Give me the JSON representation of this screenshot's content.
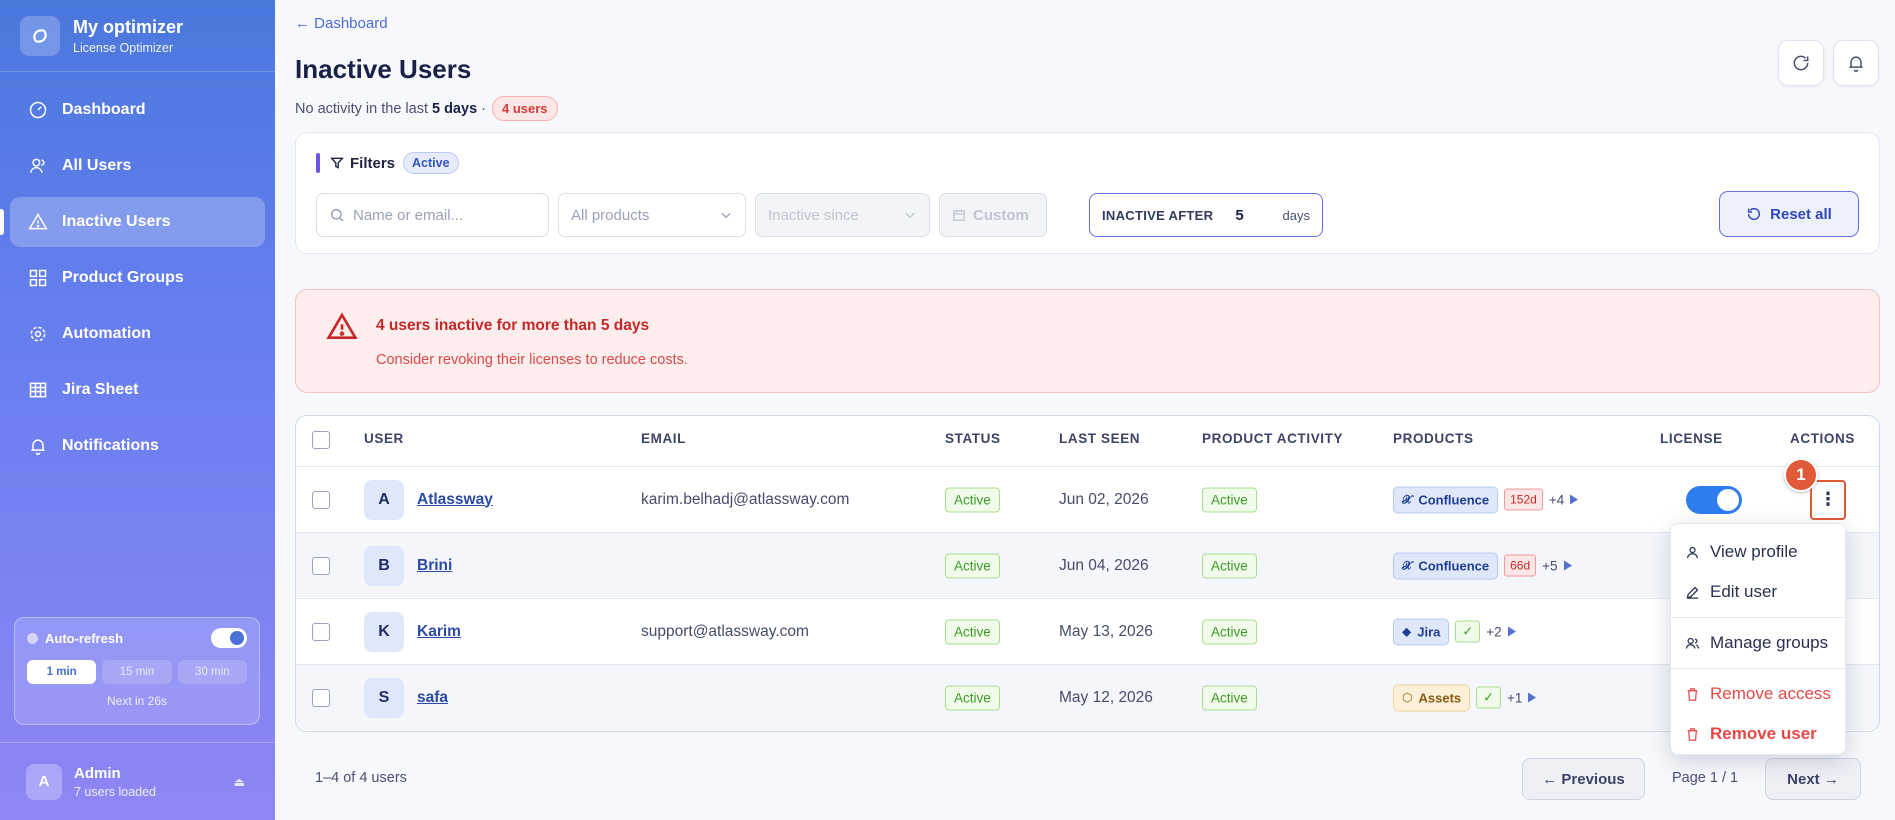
{
  "brand": {
    "name": "My optimizer",
    "subtitle": "License Optimizer"
  },
  "sidebar": {
    "items": [
      {
        "label": "Dashboard",
        "icon": "gauge-icon"
      },
      {
        "label": "All Users",
        "icon": "users-icon"
      },
      {
        "label": "Inactive Users",
        "icon": "warning-icon",
        "active": true
      },
      {
        "label": "Product Groups",
        "icon": "grid-icon"
      },
      {
        "label": "Automation",
        "icon": "gear-icon"
      },
      {
        "label": "Jira Sheet",
        "icon": "table-icon"
      },
      {
        "label": "Notifications",
        "icon": "bell-icon"
      }
    ],
    "autorefresh": {
      "label": "Auto-refresh",
      "enabled": true,
      "options": [
        "1 min",
        "15 min",
        "30 min"
      ],
      "selected": "1 min",
      "next": "Next in 26s"
    },
    "user": {
      "initial": "A",
      "name": "Admin",
      "sub": "7 users loaded"
    }
  },
  "header": {
    "back": "← Dashboard",
    "title": "Inactive Users",
    "subtitle_prefix": "No activity in the last",
    "subtitle_days": "5 days",
    "subtitle_sep": "·",
    "count_badge": "4 users"
  },
  "filters": {
    "title": "Filters",
    "status": "Active",
    "search_placeholder": "Name or email...",
    "products": "All products",
    "inactive_since": "Inactive since",
    "custom": "Custom",
    "inactive_after_label": "INACTIVE AFTER",
    "inactive_after_value": "5",
    "inactive_after_unit": "days",
    "reset": "Reset all"
  },
  "alert": {
    "title": "4 users inactive for more than 5 days",
    "desc": "Consider revoking their licenses to reduce costs."
  },
  "table": {
    "headers": {
      "user": "USER",
      "email": "EMAIL",
      "status": "STATUS",
      "last_seen": "LAST SEEN",
      "product_activity": "PRODUCT ACTIVITY",
      "products": "PRODUCTS",
      "license": "LICENSE",
      "actions": "ACTIONS"
    },
    "rows": [
      {
        "initial": "A",
        "name": "Atlassway",
        "email": "karim.belhadj@atlassway.com",
        "status": "Active",
        "last_seen": "Jun 02, 2026",
        "activity": "Active",
        "product": "Confluence",
        "product_mark": "𝒳",
        "extra": "152d",
        "more": "+4"
      },
      {
        "initial": "B",
        "name": "Brini",
        "email": "",
        "status": "Active",
        "last_seen": "Jun 04, 2026",
        "activity": "Active",
        "product": "Confluence",
        "product_mark": "𝒳",
        "extra": "66d",
        "more": "+5"
      },
      {
        "initial": "K",
        "name": "Karim",
        "email": "support@atlassway.com",
        "status": "Active",
        "last_seen": "May 13, 2026",
        "activity": "Active",
        "product": "Jira",
        "product_mark": "◆",
        "extra": "✓",
        "more": "+2"
      },
      {
        "initial": "S",
        "name": "safa",
        "email": "",
        "status": "Active",
        "last_seen": "May 12, 2026",
        "activity": "Active",
        "product": "Assets",
        "product_mark": "⬡",
        "extra": "✓",
        "more": "+1"
      }
    ],
    "step_badge": "1"
  },
  "menu": {
    "items": [
      "View profile",
      "Edit user",
      "Manage groups",
      "Remove access",
      "Remove user"
    ]
  },
  "footer": {
    "count": "1–4 of 4 users",
    "prev": "← Previous",
    "page": "Page 1 / 1",
    "next": "Next →"
  },
  "colors": {
    "accent": "#6b6ee0",
    "danger": "#e34848",
    "success": "#3e9a2a",
    "toggle": "#2f7cf0"
  }
}
